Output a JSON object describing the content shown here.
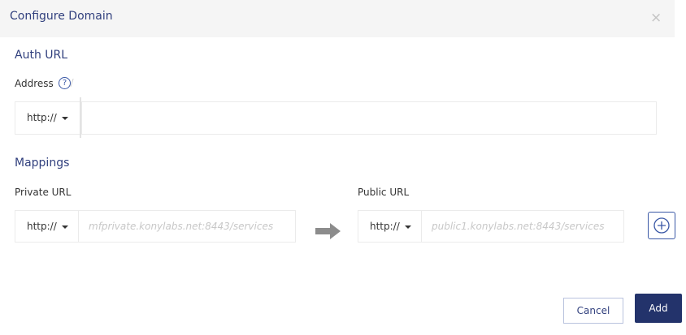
{
  "dialog": {
    "title": "Configure Domain",
    "close_glyph": "×"
  },
  "auth": {
    "section_title": "Auth URL",
    "address_label": "Address",
    "help_glyph": "?",
    "protocol": "http://",
    "address_value": ""
  },
  "mappings": {
    "section_title": "Mappings",
    "private_label": "Private URL",
    "public_label": "Public URL",
    "private_protocol": "http://",
    "private_placeholder": "mfprivate.konylabs.net:8443/services",
    "public_protocol": "http://",
    "public_placeholder": "public1.konylabs.net:8443/services"
  },
  "buttons": {
    "cancel_label": "Cancel",
    "add_label": "Add"
  },
  "icons": {
    "close": "close-icon",
    "help": "help-icon",
    "arrow": "arrow-right-icon",
    "add": "plus-circle-icon"
  },
  "colors": {
    "accent": "#303f7d",
    "primary_button": "#23336b",
    "icon_blue": "#3a58a6",
    "arrow_gray": "#8c8c8c"
  }
}
